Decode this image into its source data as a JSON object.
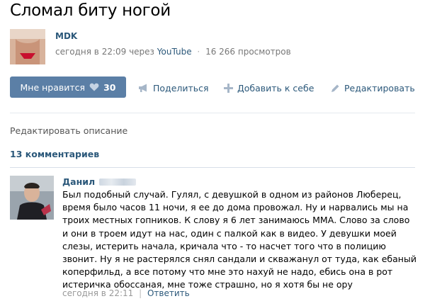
{
  "video": {
    "title": "Сломал биту ногой",
    "author": "MDK",
    "posted": "сегодня в 22:09 через",
    "source": "YouTube",
    "separator": "·",
    "views": "16 266 просмотров"
  },
  "actions": {
    "like_label": "Мне нравится",
    "like_count": "30",
    "share_label": "Поделиться",
    "add_label": "Добавить к себе",
    "edit_label": "Редактировать"
  },
  "edit_description": "Редактировать описание",
  "comments_count": "13 комментариев",
  "comment": {
    "author": "Данил",
    "lines": [
      "Был подобный случай. Гулял, с девушкой в одном из районов Люберец,",
      "время было часов 11 ночи, я ее до дома провожал. Ну и нарвались мы на",
      "троих местных гопников. К слову я 6 лет занимаюсь ММА. Слово за слово",
      "и они в троем идут на нас, один с палкой как в видео. У девушки моей",
      "слезы, истерить начала, кричала что - то насчет того что в полицию",
      "звонит. Ну я не растерялся снял сандали и скважанул от туда, как ебаный",
      "коперфильд, а все потому что мне это нахуй не надо, ебись она в рот",
      "истеричка обоссаная, мне тоже страшно, но я хотя бы не ору"
    ],
    "time": "сегодня в 22:11",
    "separator": "|",
    "reply": "Ответить"
  },
  "icons": {
    "like": "heart-icon",
    "share": "megaphone-icon",
    "add": "plus-icon",
    "edit": "pencil-icon"
  },
  "colors": {
    "link": "#2b587a",
    "button": "#5b7fa6",
    "muted": "#777777"
  }
}
